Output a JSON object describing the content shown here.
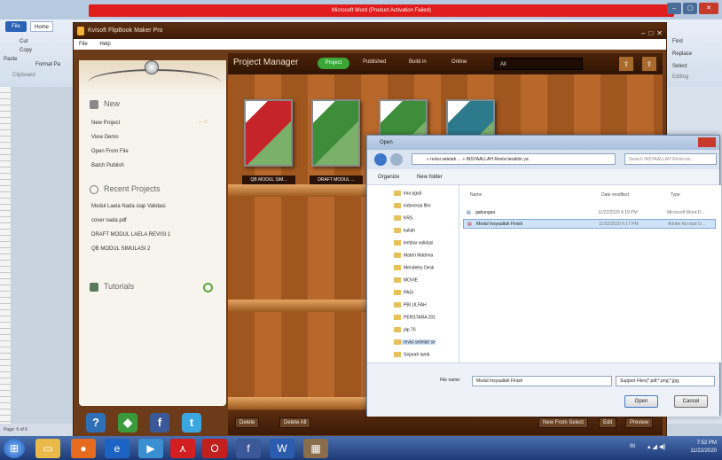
{
  "word": {
    "title": "Microsoft Word (Product Activation Failed)",
    "file_tab": "File",
    "home_tab": "Home",
    "ribbon": {
      "cut": "Cut",
      "copy": "Copy",
      "paste": "Paste",
      "format_painter": "Format Pa",
      "clipboard": "Clipboard",
      "find": "Find",
      "replace": "Replace",
      "select": "Select",
      "editing": "Editing"
    },
    "status": "Page: 6 of 6"
  },
  "flipbook": {
    "title": "Kvisoft FlipBook Maker Pro",
    "menu": [
      "File",
      "Help"
    ],
    "left_panel": {
      "new_section": "New",
      "new_items": [
        "New Project",
        "View Demo",
        "Open From File",
        "Batch Publish"
      ],
      "recent_section": "Recent Projects",
      "recent_items": [
        "Modul Laela Nada siap Validasi",
        "cover nada pdf",
        "DRAFT MODUL LAELA REVISI 1",
        "QB MODUL SIMULASI 2"
      ],
      "tutorials": "Tutorials"
    },
    "project_manager": {
      "title": "Project Manager",
      "tabs": [
        "Project",
        "Published",
        "Build in",
        "Online"
      ],
      "filter": "All"
    },
    "books": [
      {
        "label": "QB MODUL SIM...",
        "color": "#c4242a"
      },
      {
        "label": "DRAFT MODUL ...",
        "color": "#3e8d3a"
      },
      {
        "label": "",
        "color": "#3e8d3a"
      },
      {
        "label": "",
        "color": "#2c7a8c"
      }
    ],
    "bottom_buttons": [
      "Delete",
      "Delete All",
      "New From Select",
      "Edit",
      "Preview"
    ]
  },
  "dialog": {
    "title": "Open",
    "address": "« revisi setelah ... » INSYAALLAH Revisi terakhir ya",
    "search_placeholder": "Search INSYAALLAH Revisi ter...",
    "organize": "Organize",
    "new_folder": "New folder",
    "tree": [
      "ima pgsd",
      "indonesia film",
      "KRS",
      "kuliah",
      "lembar validasi",
      "Materi Matema",
      "Mendeley Desk",
      "MOVIE",
      "PASI",
      "PBI ULFAH",
      "PERSTARA 201",
      "plp 76",
      "revisi setelah se",
      "Sejarah lamb"
    ],
    "columns": [
      "Name",
      "Date modified",
      "Type"
    ],
    "files": [
      {
        "name": "gabungan",
        "date": "11/22/2020 4:19 PM",
        "type": "Microsoft Word D..."
      },
      {
        "name": "Modul Insyaallah Finish",
        "date": "11/22/2020 6:17 PM",
        "type": "Adobe Acrobat D..."
      }
    ],
    "file_name_label": "File name:",
    "file_name": "Modul Insyaallah Finish",
    "file_type": "Support Files(*.pdf;*.png;*.jpg;",
    "open": "Open",
    "cancel": "Cancel"
  },
  "taskbar": {
    "time": "7:52 PM",
    "date": "11/22/2020",
    "lang": "IN"
  }
}
